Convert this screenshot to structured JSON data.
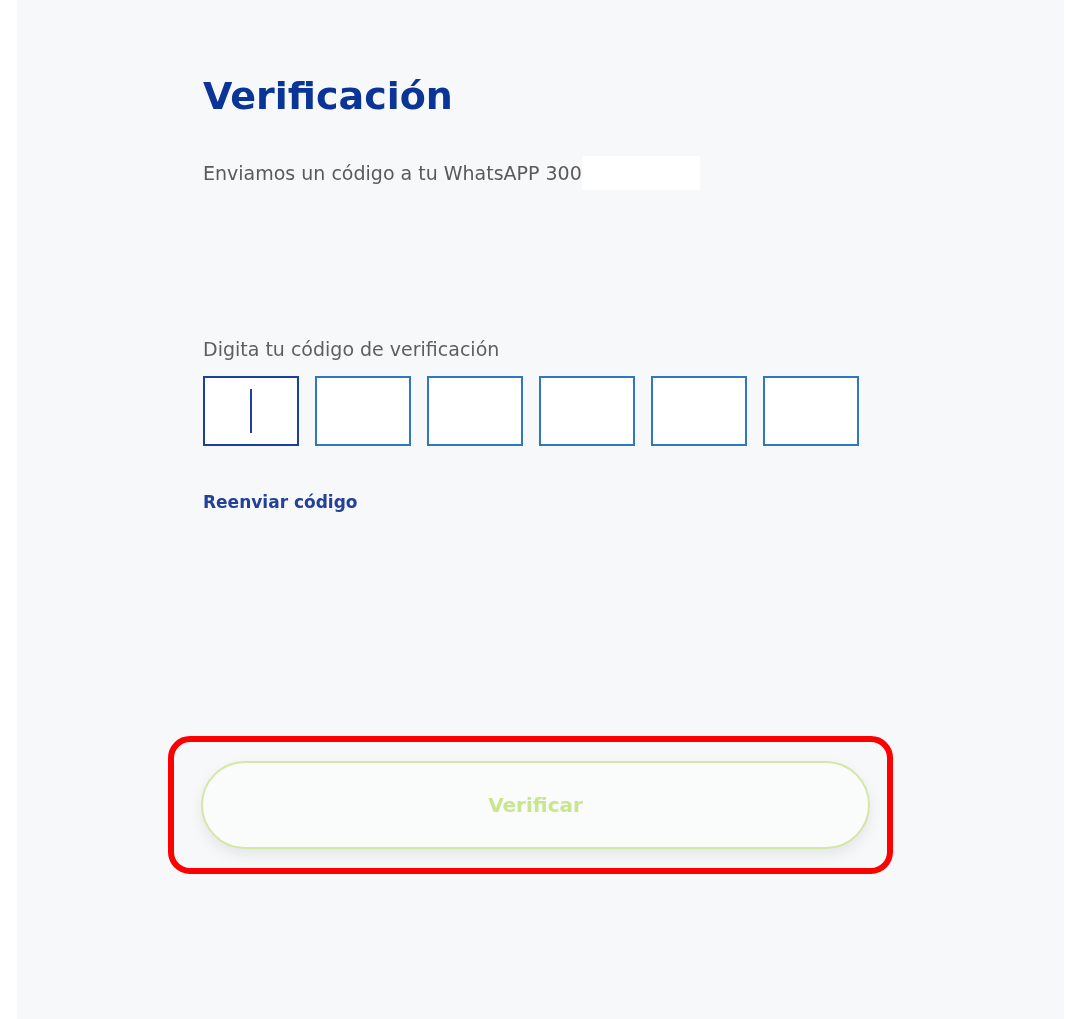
{
  "title": "Verificación",
  "message": {
    "text": "Enviamos un código a tu WhatsAPP 300",
    "redacted": true
  },
  "code_label": "Digita tu código de verificación",
  "code_boxes": [
    {
      "focused": true
    },
    {
      "focused": false
    },
    {
      "focused": false
    },
    {
      "focused": false
    },
    {
      "focused": false
    },
    {
      "focused": false
    }
  ],
  "resend_link": "Reenviar código",
  "verify_button": {
    "label": "Verificar",
    "disabled": true,
    "highlighted": true
  }
}
